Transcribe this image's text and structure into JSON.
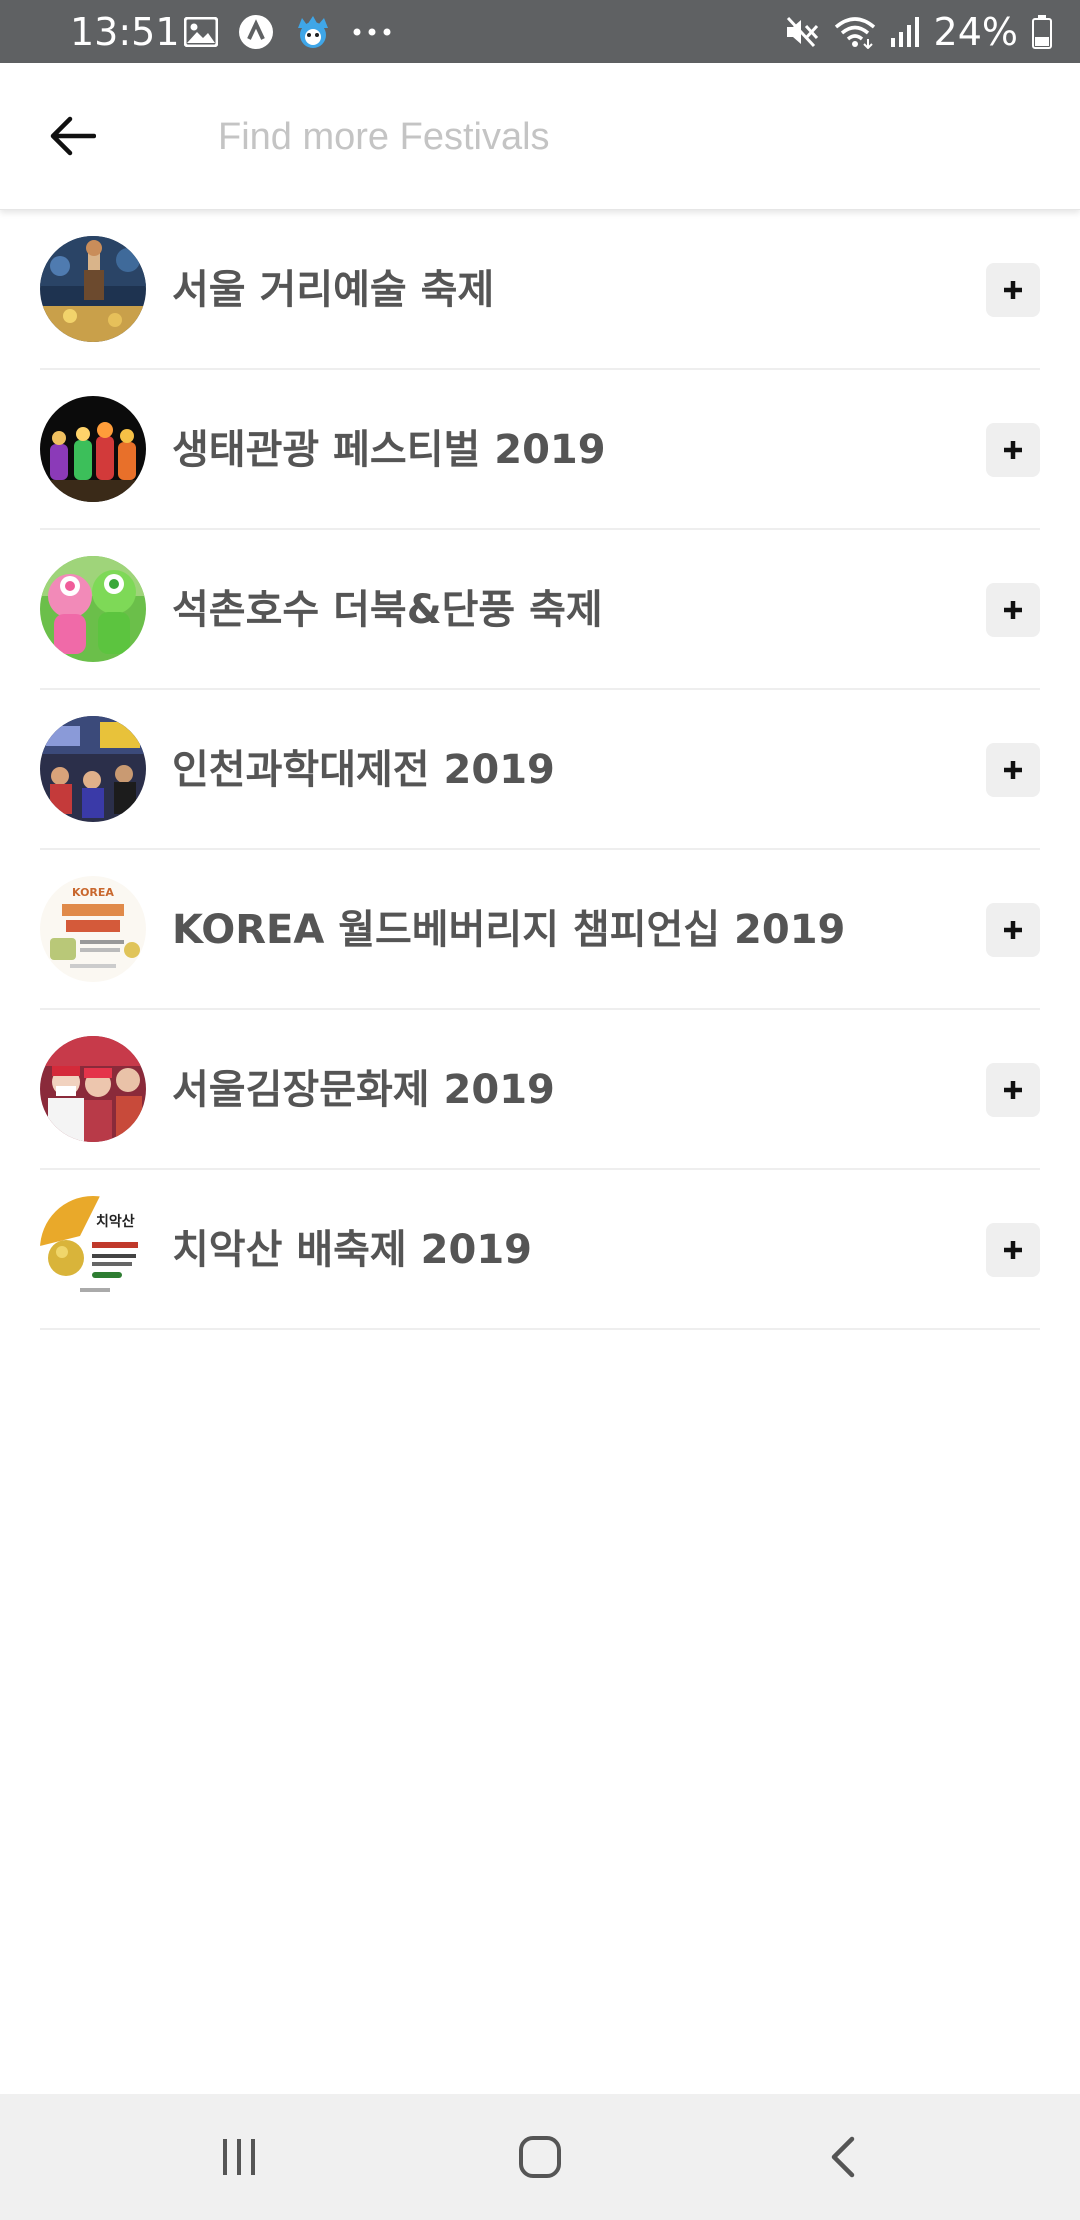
{
  "status_bar": {
    "time": "13:51",
    "battery": "24%",
    "background": "#5f6163",
    "left_icons": [
      "gallery-icon",
      "app-icon",
      "mascot-icon",
      "more-dots-icon"
    ],
    "right_icons": [
      "mute-icon",
      "wifi-icon",
      "signal-icon",
      "battery-icon"
    ]
  },
  "search": {
    "placeholder": "Find more Festivals",
    "value": ""
  },
  "festivals": [
    {
      "name": "서울 거리예술 축제",
      "thumbnail": "night-street-performance"
    },
    {
      "name": "생태관광 페스티벌 2019",
      "thumbnail": "lantern-figures"
    },
    {
      "name": "석촌호수 더북&단풍 축제",
      "thumbnail": "mascots"
    },
    {
      "name": "인천과학대제전 2019",
      "thumbnail": "science-event-crowd"
    },
    {
      "name": "KOREA 월드베버리지 챔피언십 2019",
      "thumbnail": "beverage-poster"
    },
    {
      "name": "서울김장문화제 2019",
      "thumbnail": "kimjang-people"
    },
    {
      "name": "치악산 배축제 2019",
      "thumbnail": "pear-poster"
    }
  ],
  "thumbnail_text": {
    "beverage_poster_word": "KOREA",
    "pear_poster_word": "치악산"
  },
  "colors": {
    "item_text": "#555555",
    "add_button_bg": "#efefef",
    "divider": "#eeeeee",
    "nav_bar_bg": "#f0f0f0"
  },
  "nav": [
    "recent-apps-icon",
    "home-icon",
    "back-icon"
  ]
}
